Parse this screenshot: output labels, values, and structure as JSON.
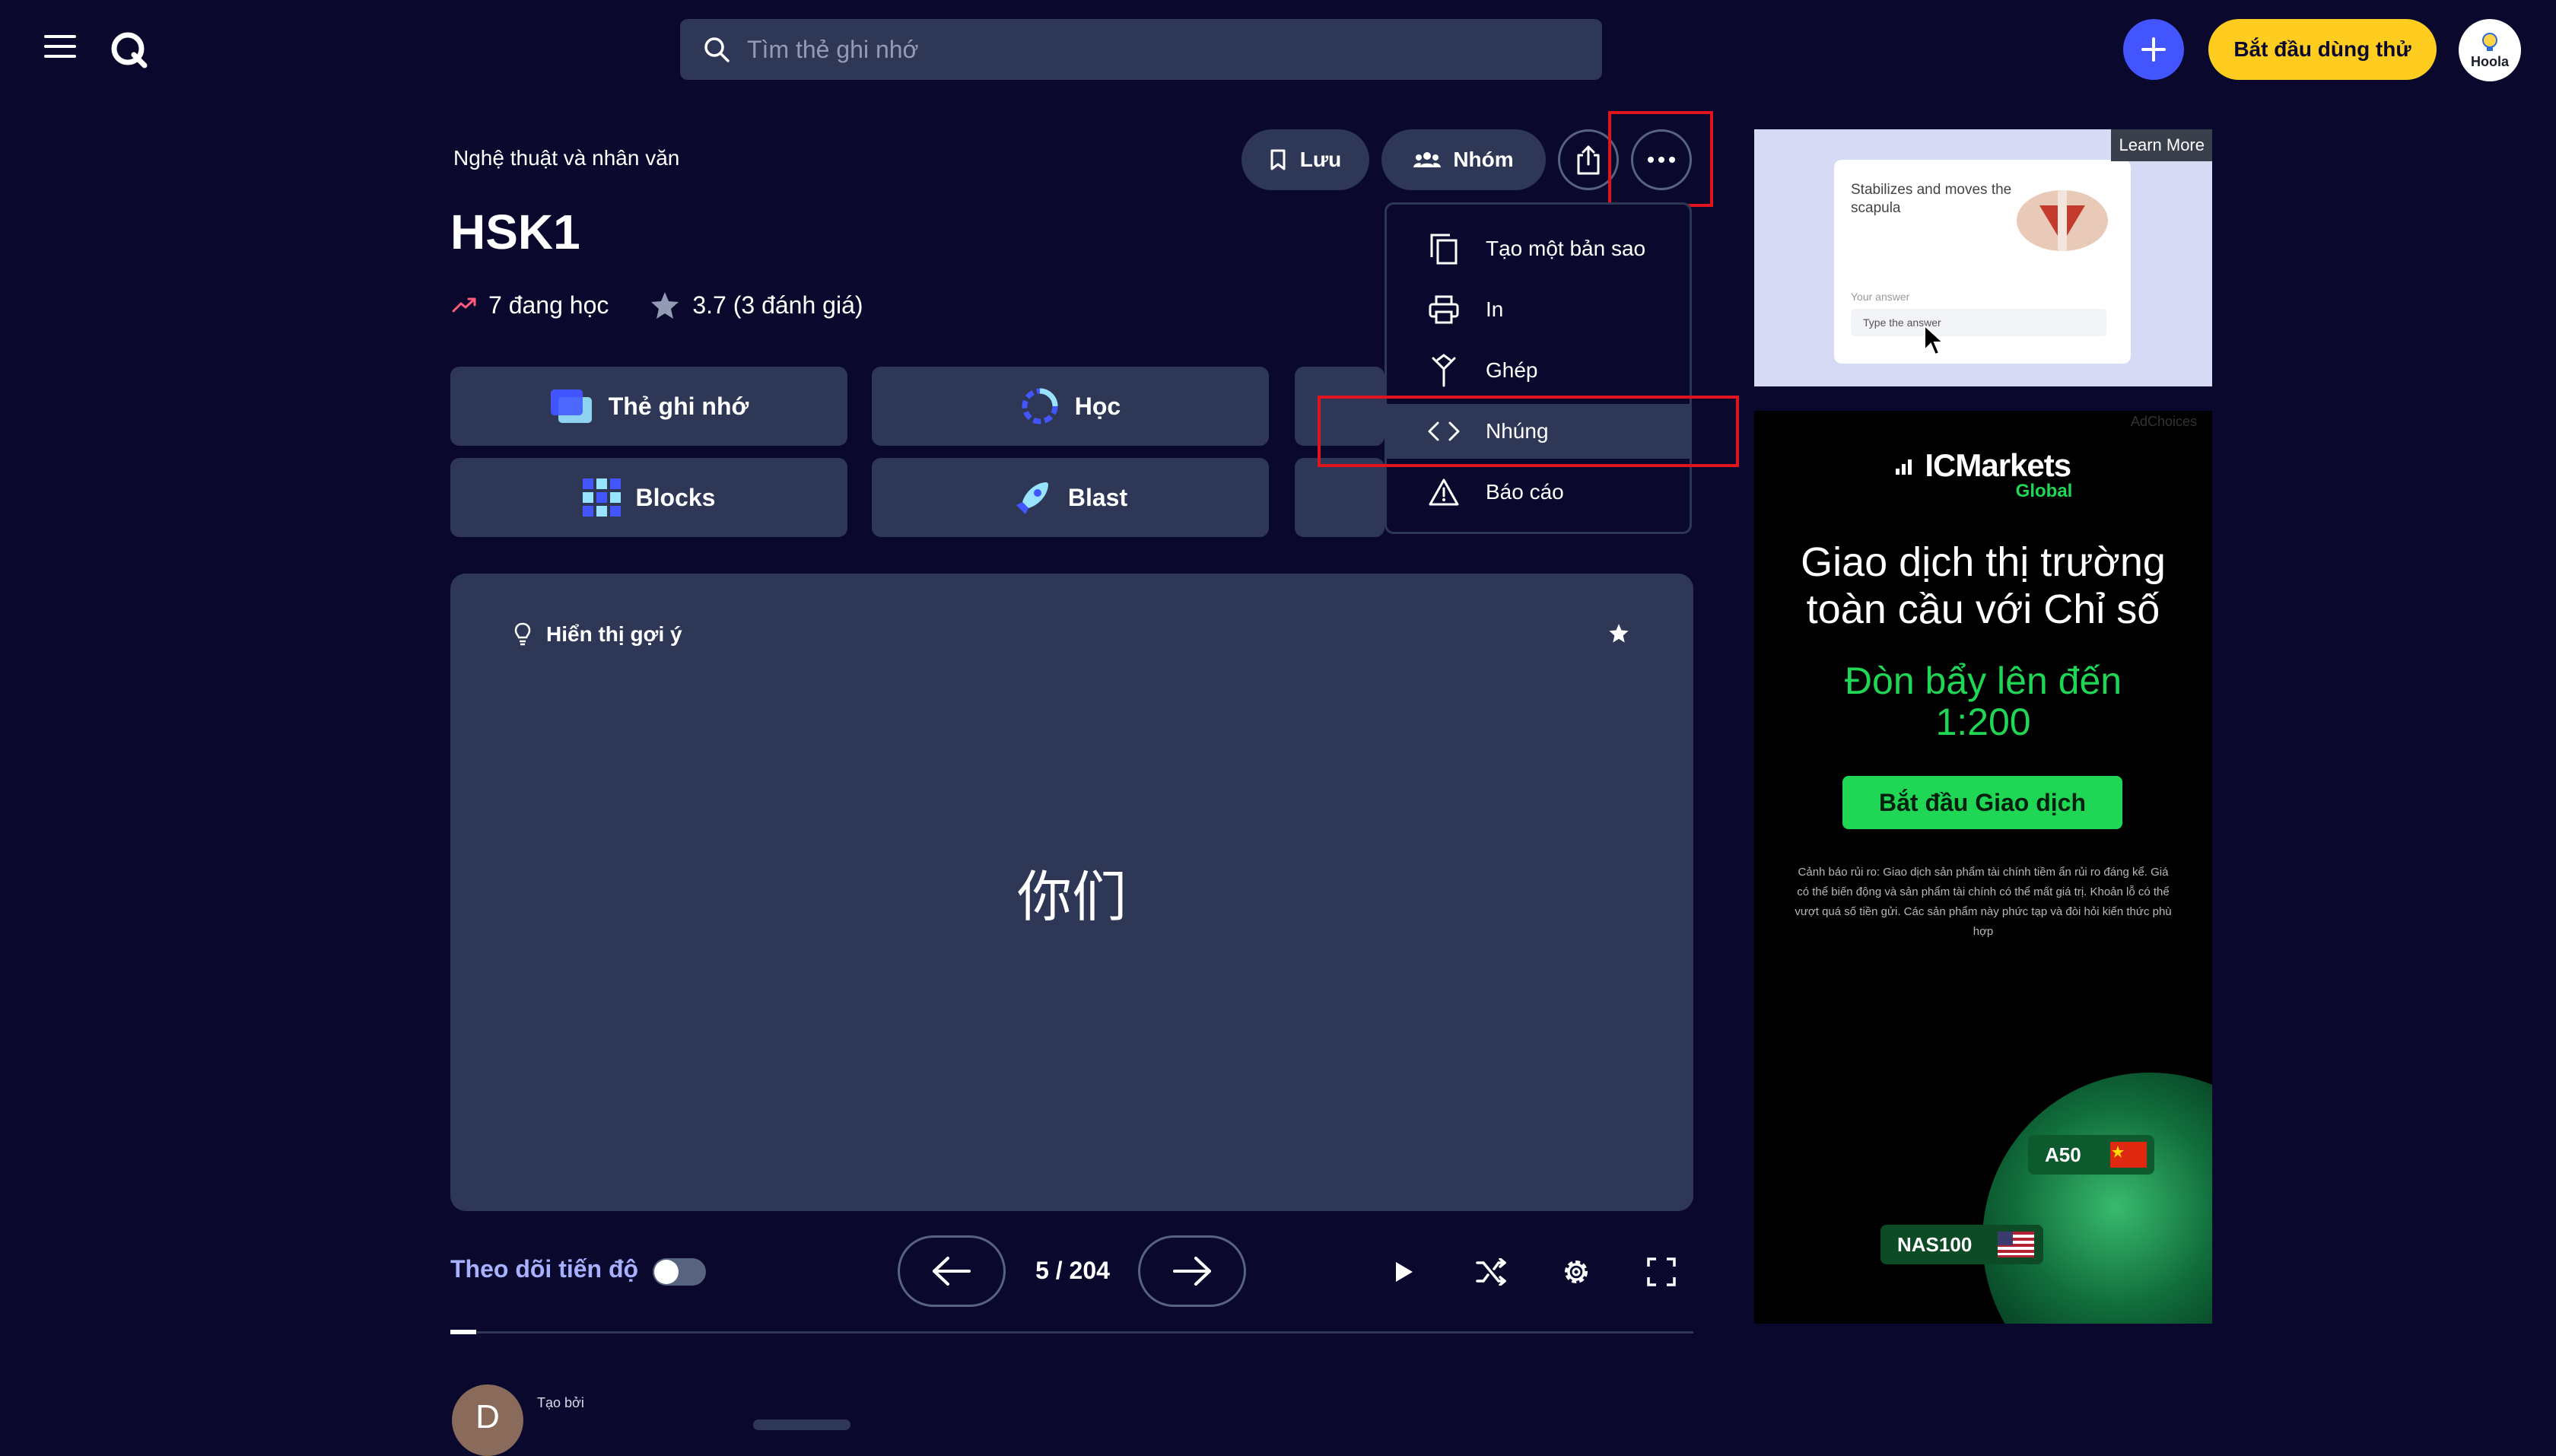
{
  "header": {
    "search_placeholder": "Tìm thẻ ghi nhớ",
    "trial_label": "Bắt đầu dùng thử",
    "avatar_text": "Hoola"
  },
  "set": {
    "breadcrumb": "Nghệ thuật và nhân văn",
    "title": "HSK1",
    "studying": "7 đang học",
    "rating": "3.7 (3 đánh giá)"
  },
  "actions": {
    "save_label": "Lưu",
    "group_label": "Nhóm"
  },
  "modes": [
    {
      "label": "Thẻ ghi nhớ"
    },
    {
      "label": "Học"
    },
    {
      "label": "Blocks"
    },
    {
      "label": "Blast"
    }
  ],
  "more_menu": {
    "items": [
      {
        "label": "Tạo một bản sao",
        "icon": "copy-icon"
      },
      {
        "label": "In",
        "icon": "printer-icon"
      },
      {
        "label": "Ghép",
        "icon": "merge-icon"
      },
      {
        "label": "Nhúng",
        "icon": "code-icon"
      },
      {
        "label": "Báo cáo",
        "icon": "warning-icon"
      }
    ]
  },
  "card": {
    "hint_label": "Hiển thị gợi ý",
    "term": "你们"
  },
  "controls": {
    "progress_label": "Theo dõi tiến độ",
    "counter": "5 / 204"
  },
  "creator": {
    "label": "Tạo bởi",
    "initial": "D"
  },
  "ads": {
    "ad1": {
      "learn_more": "Learn More",
      "question": "Stabilizes and moves the scapula",
      "answer_label": "Your answer",
      "answer_placeholder": "Type the answer"
    },
    "ad2": {
      "adchoices": "AdChoices",
      "brand": "ICMarkets",
      "brand_sub": "Global",
      "headline": "Giao dịch thị trường toàn cầu với Chỉ số",
      "leverage": "Đòn bẩy lên đến 1:200",
      "cta": "Bắt đầu Giao dịch",
      "disclaimer": "Cảnh báo rủi ro: Giao dịch sản phẩm tài chính tiềm ẩn rủi ro đáng kể. Giá có thể biến động và sản phẩm tài chính có thể mất giá trị. Khoản lỗ có thể vượt quá số tiền gửi. Các sản phẩm này phức tạp và đòi hỏi kiến thức phù hợp",
      "badge1": "A50",
      "badge2": "NAS100"
    }
  },
  "colors": {
    "background": "#0a092d",
    "surface": "#2e3856",
    "accent": "#4255ff",
    "trial": "#ffcd1f",
    "highlight": "#e0141e",
    "ad_green": "#1fd655"
  }
}
